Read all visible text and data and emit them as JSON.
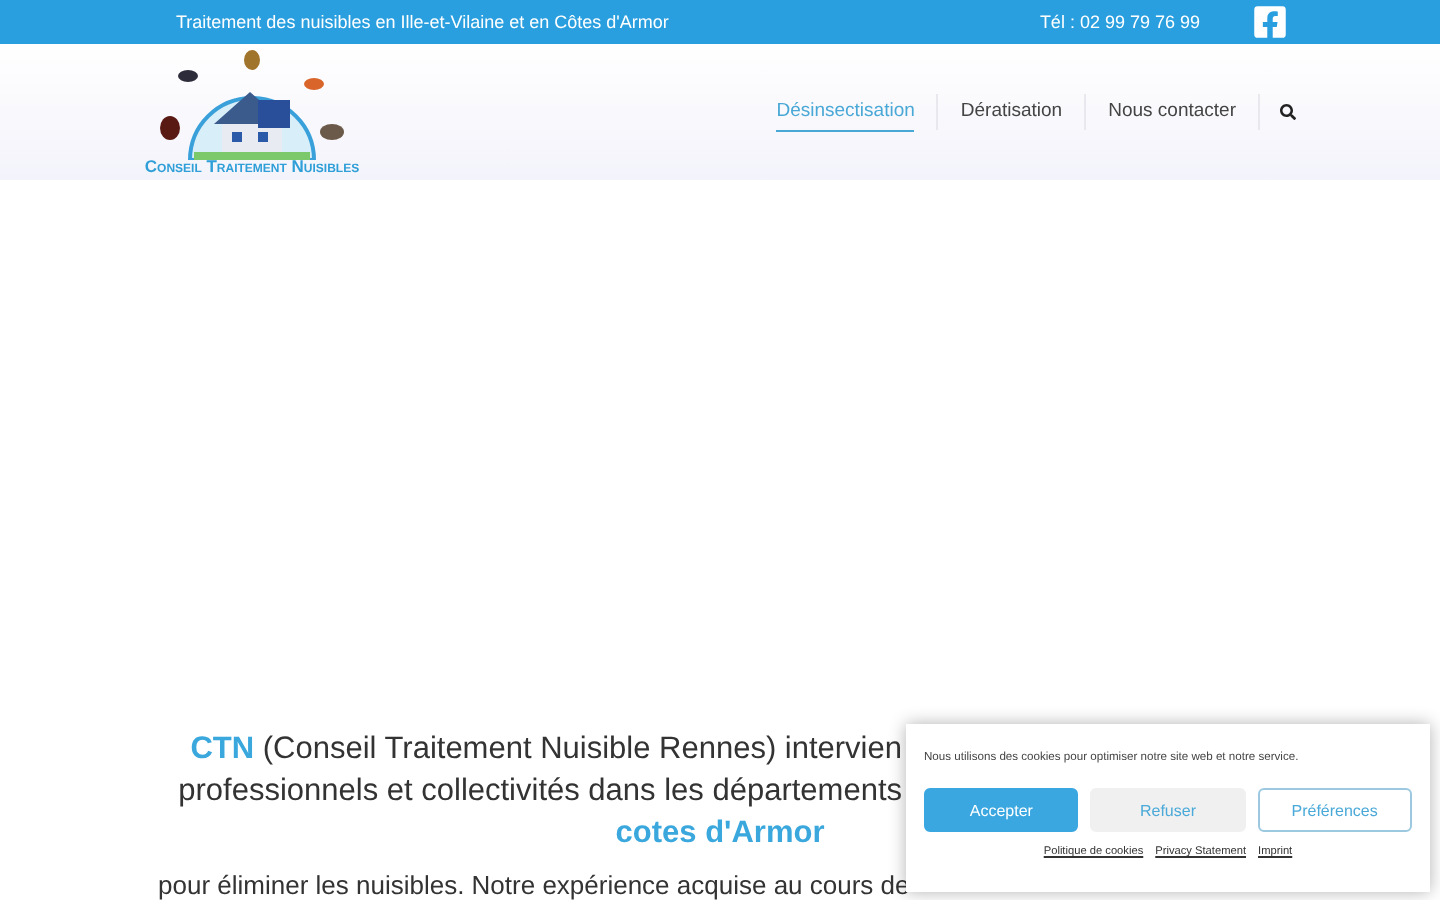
{
  "top_bar": {
    "tagline": "Traitement des nuisibles en Ille-et-Vilaine et en Côtes d'Armor",
    "phone": "Tél : 02 99 79 76 99"
  },
  "logo": {
    "name": "Conseil Traitement Nuisibles"
  },
  "nav": [
    {
      "label": "Désinsectisation",
      "selected": true
    },
    {
      "label": "Dératisation",
      "selected": false
    },
    {
      "label": "Nous contacter",
      "selected": false
    }
  ],
  "intro": {
    "line_1": "**CTN** (Conseil Traitement Nuisible Rennes) intervien",
    "line_2": "professionnels et collectivités dans les départements",
    "line_3": "cotes d'Armor",
    "line_4": "pour éliminer les nuisibles. Notre expérience acquise au cours de"
  },
  "cookie_banner": {
    "message": "Nous utilisons des cookies pour optimiser notre site web et notre service.",
    "buttons": [
      {
        "label": "Accepter",
        "kind": "primary"
      },
      {
        "label": "Refuser",
        "kind": "secondary"
      },
      {
        "label": "Préférences",
        "kind": "outline"
      }
    ],
    "links": [
      "Politique de cookies",
      "Privacy Statement",
      "Imprint"
    ]
  }
}
